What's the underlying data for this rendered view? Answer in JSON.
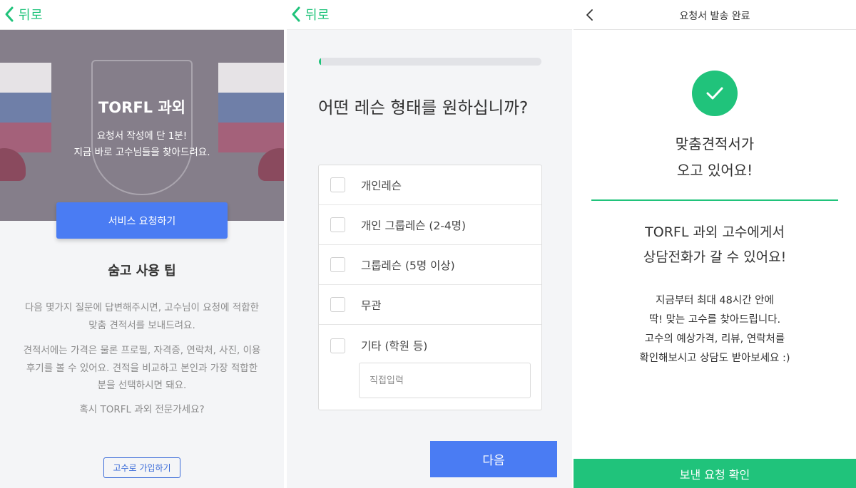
{
  "panel1": {
    "back_label": "뒤로",
    "hero": {
      "title": "TORFL 과외",
      "line1": "요청서 작성에 단 1분!",
      "line2": "지금 바로 고수님들을 찾아드려요."
    },
    "request_button": "서비스 요청하기",
    "tips_title": "숨고 사용 팁",
    "tips": [
      "다음 몇가지 질문에 답변해주시면, 고수님이 요청에 적합한",
      "맞춤 견적서를 보내드려요.",
      "견적서에는 가격은 물론 프로필, 자격증, 연락처, 사진, 이용",
      "후기를 볼 수 있어요. 견적을 비교하고 본인과 가장 적합한",
      "분을 선택하시면 돼요.",
      "혹시 TORFL 과외 전문가세요?"
    ],
    "join_button": "고수로 가입하기"
  },
  "panel2": {
    "back_label": "뒤로",
    "progress": 0.01,
    "question": "어떤 레슨 형태를 원하십니까?",
    "options": [
      "개인레슨",
      "개인 그룹레슨 (2-4명)",
      "그룹레슨 (5명 이상)",
      "무관",
      "기타 (학원 등)"
    ],
    "direct_input_placeholder": "직접입력",
    "next_button": "다음"
  },
  "panel3": {
    "title": "요청서 발송 완료",
    "headline": [
      "맞춤견적서가",
      "오고 있어요!"
    ],
    "message": [
      "TORFL 과외 고수에게서",
      "상담전화가 갈 수 있어요!"
    ],
    "details": [
      "지금부터 최대 48시간 안에",
      "딱! 맞는 고수를 찾아드립니다.",
      "고수의 예상가격, 리뷰, 연락처를",
      "확인해보시고 상담도 받아보세요 :)"
    ],
    "confirm_button": "보낸 요청 확인"
  },
  "colors": {
    "accent_green": "#20c37b",
    "button_blue": "#4a7cf3",
    "background_gray": "#f4f5f7"
  },
  "icons": [
    "chevron-left-icon",
    "checkmark-icon"
  ]
}
